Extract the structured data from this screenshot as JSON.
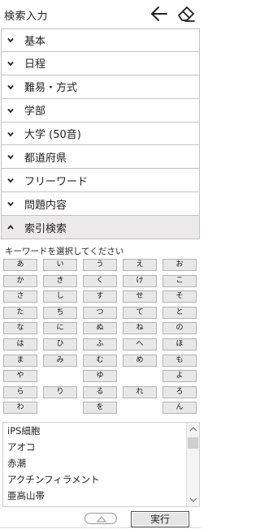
{
  "header": {
    "title": "検索入力",
    "back_icon": "arrow-left-icon",
    "clear_icon": "eraser-icon"
  },
  "accordion": {
    "items": [
      {
        "label": "基本",
        "state": "collapsed"
      },
      {
        "label": "日程",
        "state": "collapsed"
      },
      {
        "label": "難易・方式",
        "state": "collapsed"
      },
      {
        "label": "学部",
        "state": "collapsed"
      },
      {
        "label": "大学 (50音)",
        "state": "collapsed"
      },
      {
        "label": "都道府県",
        "state": "collapsed"
      },
      {
        "label": "フリーワード",
        "state": "collapsed"
      },
      {
        "label": "問題内容",
        "state": "collapsed"
      },
      {
        "label": "索引検索",
        "state": "expanded"
      }
    ]
  },
  "index_search": {
    "prompt": "キーワードを選択してください",
    "kana_rows": [
      [
        "あ",
        "い",
        "う",
        "え",
        "お"
      ],
      [
        "か",
        "き",
        "く",
        "け",
        "こ"
      ],
      [
        "さ",
        "し",
        "す",
        "せ",
        "そ"
      ],
      [
        "た",
        "ち",
        "つ",
        "て",
        "と"
      ],
      [
        "な",
        "に",
        "ぬ",
        "ね",
        "の"
      ],
      [
        "は",
        "ひ",
        "ふ",
        "へ",
        "ほ"
      ],
      [
        "ま",
        "み",
        "む",
        "め",
        "も"
      ],
      [
        "や",
        "",
        "ゆ",
        "",
        "よ"
      ],
      [
        "ら",
        "り",
        "る",
        "れ",
        "ろ"
      ],
      [
        "わ",
        "",
        "を",
        "",
        "ん"
      ]
    ],
    "keywords": [
      "iPS細胞",
      "アオコ",
      "赤潮",
      "アクチンフィラメント",
      "亜高山帯",
      "亜高山帯"
    ]
  },
  "footer": {
    "toggle_icon": "chevron-up-icon",
    "run_label": "実行"
  },
  "colors": {
    "expanded_header_bg": "#ece9ea",
    "kana_button_bg": "#e8e8e8",
    "border": "#c4c4c4"
  }
}
